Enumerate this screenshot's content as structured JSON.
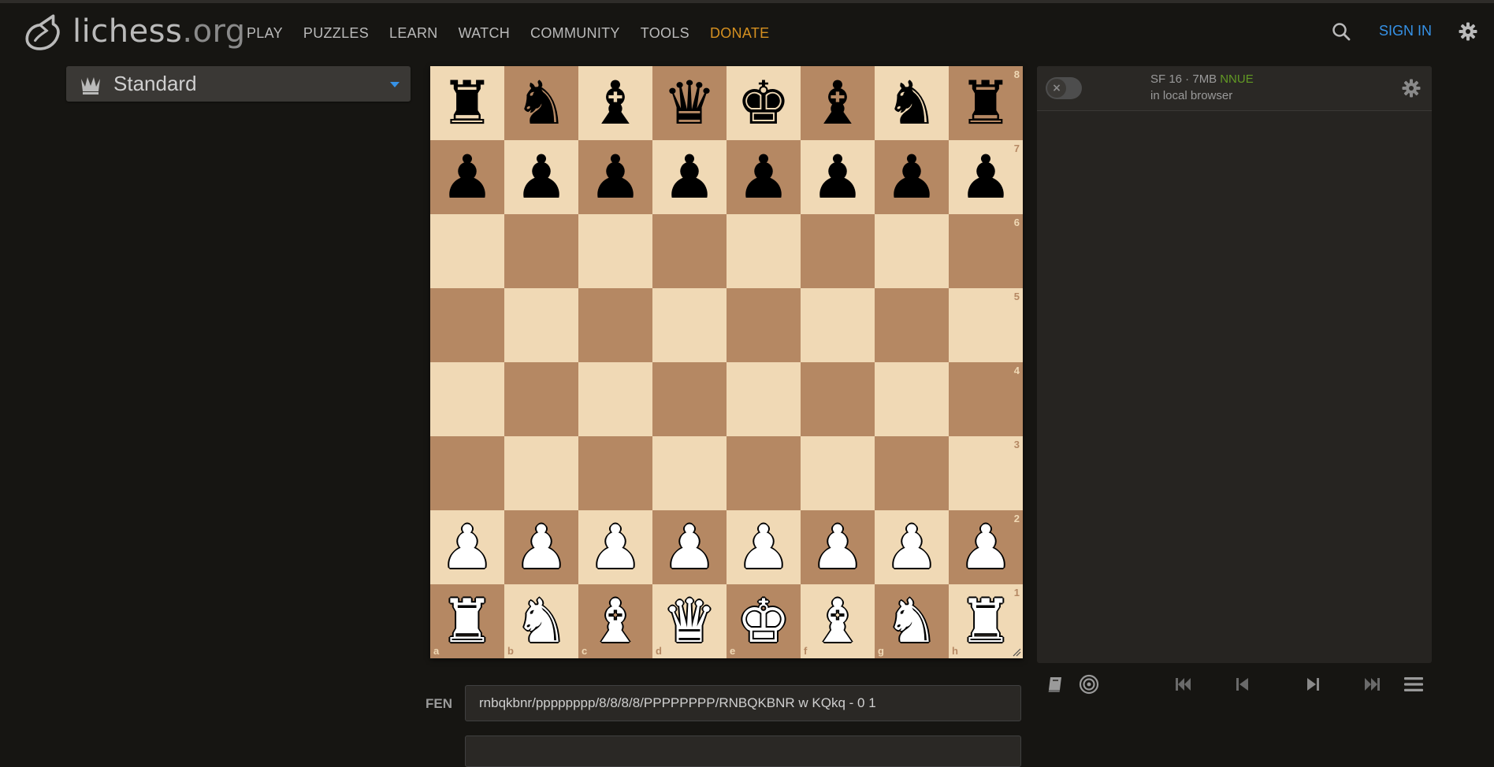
{
  "header": {
    "logo_main": "lichess",
    "logo_tld": ".org",
    "nav": [
      "PLAY",
      "PUZZLES",
      "LEARN",
      "WATCH",
      "COMMUNITY",
      "TOOLS",
      "DONATE"
    ],
    "signin": "SIGN IN",
    "icons": [
      "search-icon",
      "gear-icon"
    ]
  },
  "variant": {
    "label": "Standard",
    "icon": "crown-icon"
  },
  "board": {
    "ranks": [
      "8",
      "7",
      "6",
      "5",
      "4",
      "3",
      "2",
      "1"
    ],
    "files": [
      "a",
      "b",
      "c",
      "d",
      "e",
      "f",
      "g",
      "h"
    ],
    "position": [
      [
        "r",
        "n",
        "b",
        "q",
        "k",
        "b",
        "n",
        "r"
      ],
      [
        "p",
        "p",
        "p",
        "p",
        "p",
        "p",
        "p",
        "p"
      ],
      [
        "",
        "",
        "",
        "",
        "",
        "",
        "",
        ""
      ],
      [
        "",
        "",
        "",
        "",
        "",
        "",
        "",
        ""
      ],
      [
        "",
        "",
        "",
        "",
        "",
        "",
        "",
        ""
      ],
      [
        "",
        "",
        "",
        "",
        "",
        "",
        "",
        ""
      ],
      [
        "P",
        "P",
        "P",
        "P",
        "P",
        "P",
        "P",
        "P"
      ],
      [
        "R",
        "N",
        "B",
        "Q",
        "K",
        "B",
        "N",
        "R"
      ]
    ],
    "light_color": "#f0d9b5",
    "dark_color": "#b58863"
  },
  "engine": {
    "name": "SF 16 · 7MB",
    "tag": "NNUE",
    "sub": "in local browser",
    "enabled": false
  },
  "controls": [
    "book-icon",
    "target-icon",
    "first-icon",
    "prev-icon",
    "next-icon",
    "last-icon",
    "menu-icon"
  ],
  "fen": {
    "label": "FEN",
    "value": "rnbqkbnr/pppppppp/8/8/8/8/PPPPPPPP/RNBQKBNR w KQkq - 0 1"
  }
}
